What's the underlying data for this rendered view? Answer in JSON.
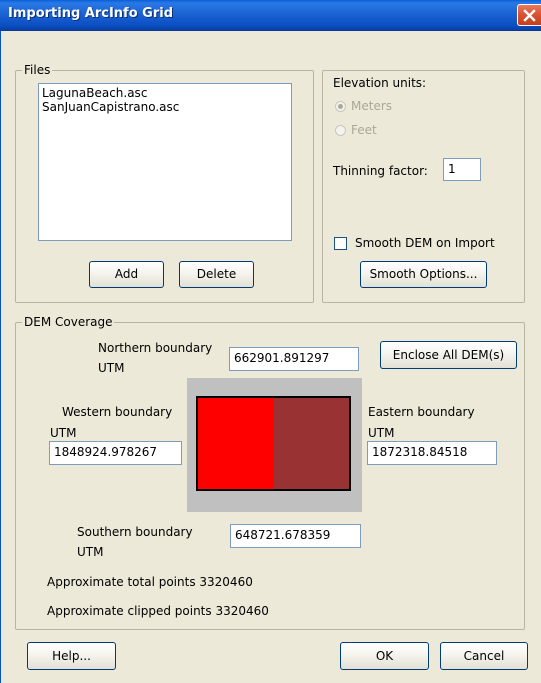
{
  "window": {
    "title": "Importing ArcInfo Grid"
  },
  "files": {
    "group_label": "Files",
    "items": [
      "LagunaBeach.asc",
      "SanJuanCapistrano.asc"
    ],
    "add_label": "Add",
    "delete_label": "Delete"
  },
  "elevation": {
    "label": "Elevation units:",
    "options": [
      "Meters",
      "Feet"
    ],
    "selected": "Meters",
    "thinning_label": "Thinning factor:",
    "thinning_value": "1",
    "smooth_label": "Smooth DEM on Import",
    "smooth_checked": false,
    "smooth_options_label": "Smooth Options..."
  },
  "coverage": {
    "group_label": "DEM Coverage",
    "northern_label": "Northern boundary",
    "northern_unit": "UTM",
    "northern_value": "662901.891297",
    "enclose_label": "Enclose All DEM(s)",
    "western_label": "Western boundary",
    "western_unit": "UTM",
    "western_value": "1848924.978267",
    "eastern_label": "Eastern boundary",
    "eastern_unit": "UTM",
    "eastern_value": "1872318.84518",
    "southern_label": "Southern boundary",
    "southern_unit": "UTM",
    "southern_value": "648721.678359",
    "total_points": "Approximate total points 3320460",
    "clipped_points": "Approximate clipped points 3320460",
    "preview_colors": {
      "background": "#c0c0c0",
      "dem_left": "#ff0000",
      "dem_right": "#993333"
    }
  },
  "footer": {
    "help_label": "Help...",
    "ok_label": "OK",
    "cancel_label": "Cancel"
  },
  "colors": {
    "titlebar": "#0b4fc2",
    "dialog_bg": "#ece9d8",
    "close_button": "#d9512e"
  }
}
